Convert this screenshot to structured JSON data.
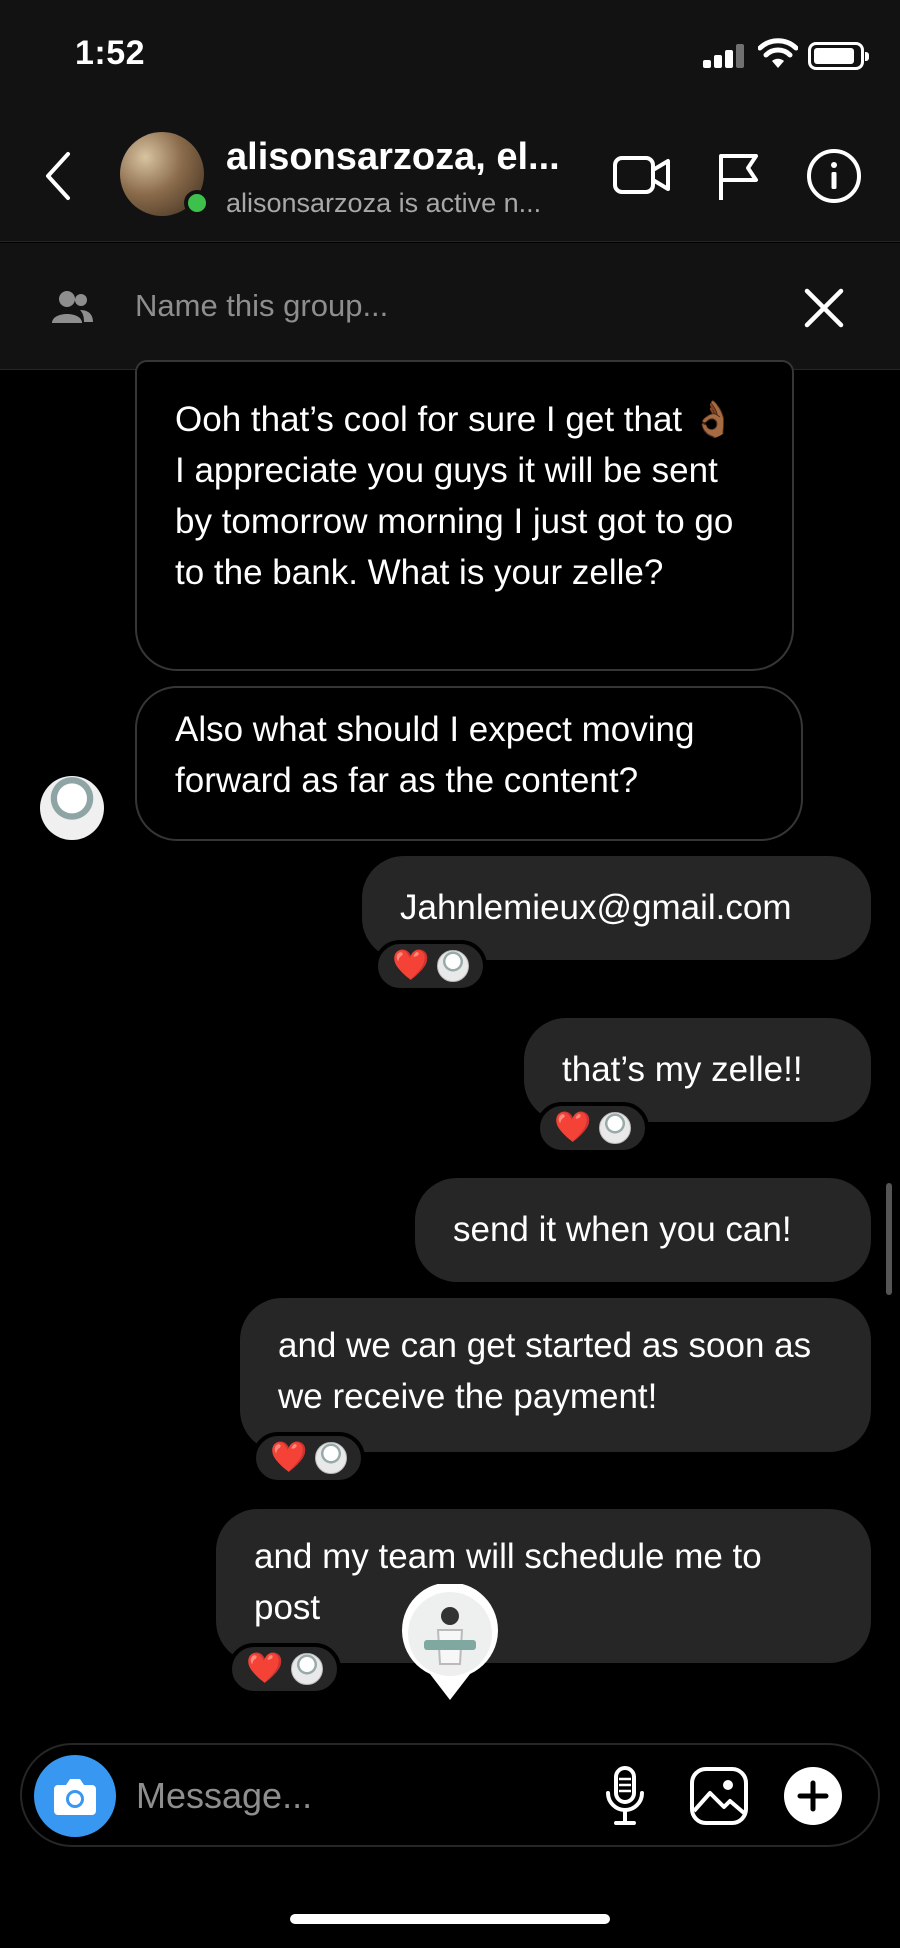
{
  "status_bar": {
    "time": "1:52",
    "icons": [
      "signal-icon",
      "wifi-icon",
      "battery-icon"
    ]
  },
  "header": {
    "title": "alisonsarzoza, el...",
    "subtitle": "alisonsarzoza is active n...",
    "icons": [
      "back-icon",
      "video-call-icon",
      "flag-icon",
      "info-icon"
    ]
  },
  "group_bar": {
    "placeholder": "Name this group...",
    "icons": [
      "group-icon",
      "close-icon"
    ]
  },
  "messages": [
    {
      "direction": "incoming",
      "text": "Ooh that’s cool for sure I get that 👌🏾 I appreciate you guys it will be sent by tomorrow morning I just got to go to the bank. What is your zelle?"
    },
    {
      "direction": "incoming",
      "text": "Also what should I expect moving forward as far as the content?"
    },
    {
      "direction": "outgoing",
      "text": "Jahnlemieux@gmail.com",
      "reaction": "❤️"
    },
    {
      "direction": "outgoing",
      "text": "that’s my zelle!!",
      "reaction": "❤️"
    },
    {
      "direction": "outgoing",
      "text": "send it when you can!"
    },
    {
      "direction": "outgoing",
      "text": "and we can get started as soon as we receive the payment!",
      "reaction": "❤️"
    },
    {
      "direction": "outgoing",
      "text": "and my team will schedule me to post",
      "reaction": "❤️"
    }
  ],
  "composer": {
    "placeholder": "Message...",
    "icons": [
      "camera-icon",
      "microphone-icon",
      "gallery-icon",
      "plus-icon"
    ]
  },
  "colors": {
    "background": "#000000",
    "header": "#121212",
    "outgoing_bubble": "#262626",
    "incoming_border": "#363636",
    "camera_button": "#3897f0",
    "online": "#3ec14c"
  }
}
